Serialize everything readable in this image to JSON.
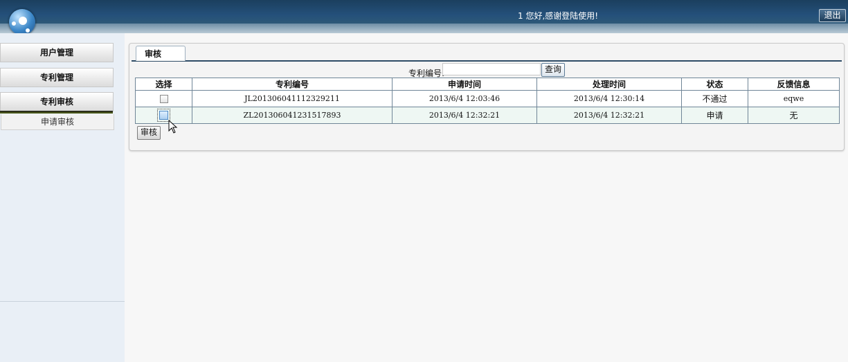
{
  "header": {
    "welcome": "1 您好,感谢登陆使用!",
    "logout_label": "退出"
  },
  "sidebar": {
    "items": [
      {
        "label": "用户管理"
      },
      {
        "label": "专利管理"
      },
      {
        "label": "专利审核"
      }
    ],
    "subitems": [
      {
        "label": "申请审核"
      }
    ]
  },
  "main": {
    "tab_label": "审核",
    "search": {
      "label": "专利编号:",
      "value": "",
      "button_label": "查询"
    },
    "table": {
      "headers": [
        "选择",
        "专利编号",
        "申请时间",
        "处理时间",
        "状态",
        "反馈信息"
      ],
      "rows": [
        {
          "id": "JL201306041112329211",
          "apply_time": "2013/6/4 12:03:46",
          "process_time": "2013/6/4 12:30:14",
          "status": "不通过",
          "feedback": "eqwe"
        },
        {
          "id": "ZL201306041231517893",
          "apply_time": "2013/6/4 12:32:21",
          "process_time": "2013/6/4 12:32:21",
          "status": "申请",
          "feedback": "无"
        }
      ]
    },
    "audit_button_label": "审核"
  },
  "colors": {
    "header_dark": "#1b3f5e",
    "sidebar_bg": "#e9eff6",
    "table_border": "#6f8597",
    "row_alt": "#eef7f3"
  }
}
